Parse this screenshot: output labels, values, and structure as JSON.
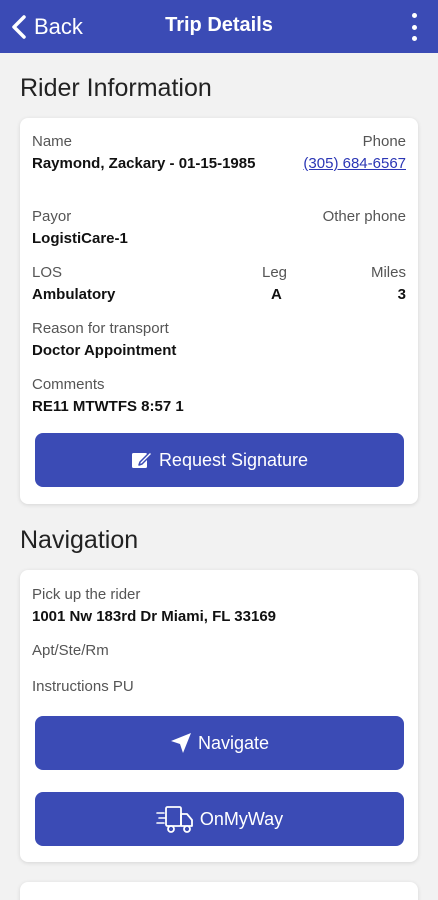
{
  "appbar": {
    "back_label": "Back",
    "title": "Trip Details",
    "menu_icon": "more-vertical-icon",
    "color": "#3b4bb5"
  },
  "rider": {
    "section_title": "Rider Information",
    "name_label": "Name",
    "name_value": "Raymond, Zackary - 01-15-1985",
    "phone_label": "Phone",
    "phone_value": "(305) 684-6567",
    "payor_label": "Payor",
    "payor_value": "LogistiCare-1",
    "other_phone_label": "Other phone",
    "los_label": "LOS",
    "los_value": "Ambulatory",
    "leg_label": "Leg",
    "leg_value": "A",
    "miles_label": "Miles",
    "miles_value": "3",
    "reason_label": "Reason for transport",
    "reason_value": "Doctor Appointment",
    "comments_label": "Comments",
    "comments_value": "RE11 MTWTFS 8:57 1",
    "request_signature_label": "Request Signature",
    "request_signature_icon": "edit-square-icon"
  },
  "navigation": {
    "section_title": "Navigation",
    "pickup_label": "Pick up the rider",
    "pickup_address": "1001 Nw 183rd Dr Miami, FL 33169",
    "apt_label": "Apt/Ste/Rm",
    "instructions_label": "Instructions PU",
    "navigate_label": "Navigate",
    "navigate_icon": "navigation-arrow-icon",
    "onmyway_label": "OnMyWay",
    "onmyway_icon": "delivery-truck-icon"
  }
}
